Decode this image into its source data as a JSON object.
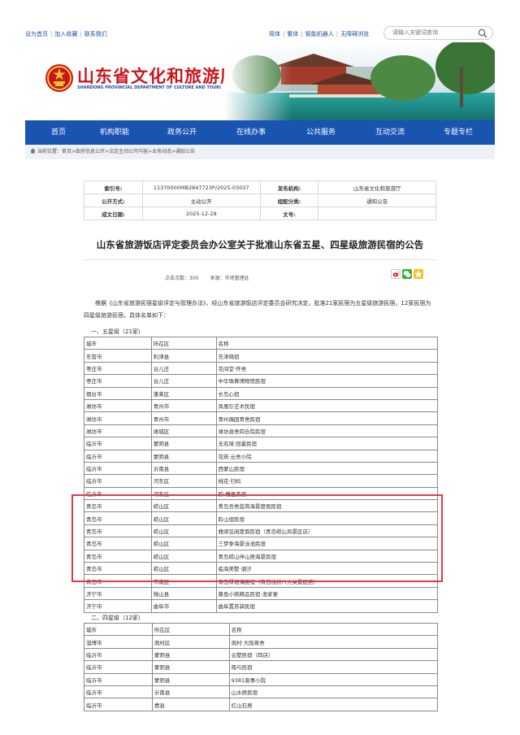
{
  "topbar": {
    "left_links": [
      "设为首页",
      "加入收藏",
      "联系我们"
    ],
    "right_links": [
      "简体",
      "繁体",
      "智能机器人",
      "无障碍浏览"
    ],
    "search_placeholder": "请输入关键词查询"
  },
  "logo": {
    "name_cn": "山东省文化和旅游厅",
    "name_en": "SHANDONG PROVINCIAL DEPARTMENT OF CULTURE AND TOURI"
  },
  "nav": [
    "首页",
    "机构职能",
    "政务公开",
    "在线办事",
    "公共服务",
    "互动交流",
    "专题专栏"
  ],
  "breadcrumb": "当前位置：首页>政府信息公开>法定主动公开内容>业务动态>通知公告",
  "meta": {
    "rows": [
      [
        {
          "k": "索引号:",
          "v": "11370000MB2847723P/2025-03037"
        },
        {
          "k": "发布机构:",
          "v": "山东省文化和旅游厅"
        }
      ],
      [
        {
          "k": "公开方式:",
          "v": "主动公开"
        },
        {
          "k": "组配分类:",
          "v": "通知公告"
        }
      ],
      [
        {
          "k": "成文日期:",
          "v": "2025-12-29"
        },
        {
          "k": "文号:",
          "v": ""
        }
      ]
    ]
  },
  "article": {
    "title": "山东省旅游饭店评定委员会办公室关于批准山东省五星、四星级旅游民宿的公告",
    "clicks_label": "点击次数：",
    "clicks": "300",
    "source_label": "来源：",
    "source": "市场管理处",
    "intro": "根据《山东省旅游民宿星级评定与管理办法》，经山东省旅游饭店评定委员会研究决定，批准21家民宿为五星级旅游民宿，12家民宿为四星级旅游民宿，具体名单如下："
  },
  "five_star": {
    "heading": "一、五星级（21家）",
    "header": [
      "城市",
      "所在区",
      "名称"
    ],
    "rows": [
      [
        "东营市",
        "利津县",
        "东津晓宿"
      ],
      [
        "枣庄市",
        "台儿庄",
        "花间堂·怀舍"
      ],
      [
        "枣庄市",
        "台儿庄",
        "中华珠算博物馆民宿"
      ],
      [
        "烟台市",
        "蓬莱区",
        "长岛心宿"
      ],
      [
        "潍坊市",
        "青州市",
        "凤凰引艺术民宿"
      ],
      [
        "潍坊市",
        "青州市",
        "青州偶园青舍民宿"
      ],
      [
        "潍坊市",
        "潍城区",
        "潍坊县舍四合院民宿"
      ],
      [
        "临沂市",
        "蒙阴县",
        "无名境·回巢民宿"
      ],
      [
        "临沂市",
        "蒙阴县",
        "花筑·云舍小院"
      ],
      [
        "临沂市",
        "沂南县",
        "西蒙山民宿"
      ],
      [
        "临沂市",
        "河东区",
        "桃花·归屿"
      ],
      [
        "临沂市",
        "河东区",
        "酌·槽里美宿"
      ],
      [
        "青岛市",
        "崂山区",
        "青岛吾舍蓝简海景度假民宿"
      ],
      [
        "青岛市",
        "崂山区",
        "聆山宿民宿"
      ],
      [
        "青岛市",
        "崂山区",
        "雅颂见阅度假民宿（青岛崂山风景区店）"
      ],
      [
        "青岛市",
        "崂山区",
        "三梦季海景泳池民宿"
      ],
      [
        "青岛市",
        "崂山区",
        "青岛崂山伴山居海景民宿"
      ],
      [
        "青岛市",
        "崂山区",
        "临海美墅·潮汐"
      ],
      [
        "青岛市",
        "市南区",
        "青岛琴语海民宿（青岛栈桥八大关景区店）"
      ],
      [
        "济宁市",
        "微山县",
        "慕鱼小筑精品民宿·渔家宴"
      ],
      [
        "济宁市",
        "曲阜市",
        "曲阜置苏驿民宿"
      ]
    ]
  },
  "four_star": {
    "heading": "二、四星级（12家）",
    "header": [
      "城市",
      "所在区",
      "名称"
    ],
    "rows": [
      [
        "淄博市",
        "周村区",
        "周村·大隐寒舍"
      ],
      [
        "临沂市",
        "蒙阴县",
        "云墅民宿（四店）"
      ],
      [
        "临沂市",
        "蒙阴县",
        "楮与民宿"
      ],
      [
        "临沂市",
        "蒙阴县",
        "9381崮事小院"
      ],
      [
        "临沂市",
        "沂南县",
        "山水居民宿"
      ],
      [
        "临沂市",
        "费县",
        "红山石居"
      ]
    ]
  },
  "colors": {
    "nav_bg": "#1a54b1",
    "brand_red": "#c9161c",
    "highlight": "#e53a45"
  }
}
